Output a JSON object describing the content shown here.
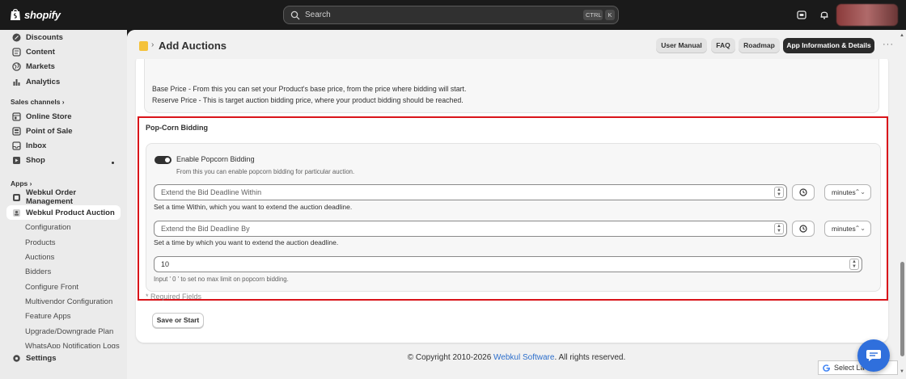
{
  "topbar": {
    "brand": "shopify",
    "search_placeholder": "Search",
    "shortcut_ctrl": "CTRL",
    "shortcut_k": "K"
  },
  "sidebar": {
    "items_top": [
      {
        "label": "Discounts",
        "icon": "discount-icon"
      },
      {
        "label": "Content",
        "icon": "content-icon"
      },
      {
        "label": "Markets",
        "icon": "globe-icon"
      },
      {
        "label": "Analytics",
        "icon": "bar-chart-icon"
      }
    ],
    "sales_channels_label": "Sales channels",
    "channels": [
      {
        "label": "Online Store",
        "icon": "store-icon"
      },
      {
        "label": "Point of Sale",
        "icon": "pos-icon"
      },
      {
        "label": "Inbox",
        "icon": "inbox-icon"
      },
      {
        "label": "Shop",
        "icon": "shop-icon"
      }
    ],
    "apps_label": "Apps",
    "apps": [
      {
        "label": "Webkul Order Management"
      },
      {
        "label": "Webkul Product Auction"
      }
    ],
    "sub_items": [
      "Configuration",
      "Products",
      "Auctions",
      "Bidders",
      "Configure Front",
      "Multivendor Configuration",
      "Feature Apps",
      "Upgrade/Downgrade Plan",
      "WhatsApp Notification Logs"
    ],
    "settings_label": "Settings"
  },
  "header": {
    "title": "Add Auctions",
    "buttons": [
      "User Manual",
      "FAQ",
      "Roadmap",
      "App Information & Details"
    ],
    "more": "···"
  },
  "info": {
    "line1": "Base Price - From this you can set your Product's base price, from the price where bidding will start.",
    "line2": "Reserve Price - This is target auction bidding price, where your product bidding should be reached."
  },
  "popcorn": {
    "title": "Pop-Corn Bidding",
    "toggle_label": "Enable Popcorn Bidding",
    "toggle_on": true,
    "toggle_help": "From this you can enable popcorn bidding for particular auction.",
    "within_placeholder": "Extend the Bid Deadline Within",
    "within_unit": "minutes",
    "within_help": "Set a time Within, which you want to extend the auction deadline.",
    "by_placeholder": "Extend the Bid Deadline By",
    "by_unit": "minutes",
    "by_help": "Set a time by which you want to extend the auction deadline.",
    "limit_value": "10",
    "limit_help": "Input ' 0 ' to set no max limit on popcorn bidding.",
    "required_note": "* Required Fields"
  },
  "save_button": "Save or Start",
  "footer": {
    "prefix": "© Copyright 2010-2026 ",
    "link": "Webkul Software",
    "suffix": ". All rights reserved."
  },
  "translate": {
    "label": "Select La"
  },
  "colors": {
    "highlight_border": "#d9141a",
    "link": "#2c6ecb",
    "chat": "#2f6fdc"
  }
}
